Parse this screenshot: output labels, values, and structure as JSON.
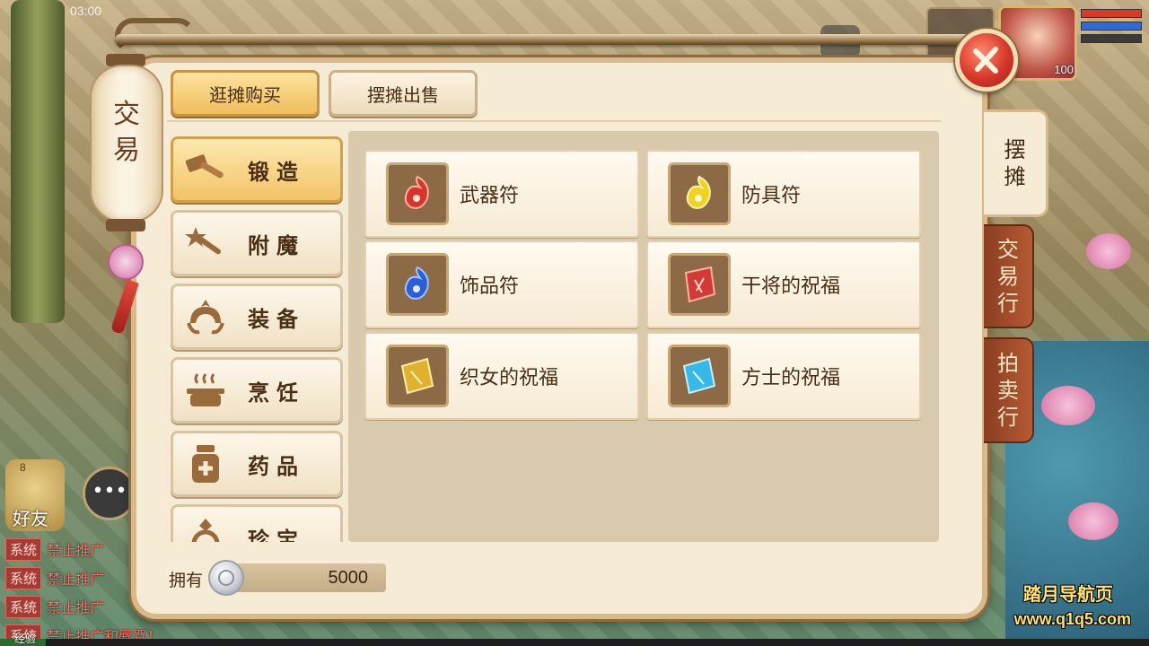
{
  "status_bar": {
    "time": "03:00"
  },
  "hud": {
    "player_level": "100"
  },
  "panel": {
    "title_chars": [
      "交",
      "易"
    ],
    "top_tabs": [
      {
        "label": "逛摊购买",
        "active": true
      },
      {
        "label": "摆摊出售",
        "active": false
      }
    ],
    "side_tabs": [
      {
        "label": "摆\n摊",
        "active": true
      },
      {
        "label": "交\n易\n行",
        "active": false
      },
      {
        "label": "拍\n卖\n行",
        "active": false
      }
    ],
    "categories": [
      {
        "label": "锻造",
        "icon": "hammer-icon",
        "active": true
      },
      {
        "label": "附魔",
        "icon": "magic-wand-icon",
        "active": false
      },
      {
        "label": "装备",
        "icon": "helmet-icon",
        "active": false
      },
      {
        "label": "烹饪",
        "icon": "cooking-pot-icon",
        "active": false
      },
      {
        "label": "药品",
        "icon": "medicine-jar-icon",
        "active": false
      },
      {
        "label": "珍宝",
        "icon": "ring-icon",
        "active": false
      }
    ],
    "items": [
      {
        "name": "武器符",
        "icon": "red-talisman-icon",
        "color": "#d9342b"
      },
      {
        "name": "防具符",
        "icon": "yellow-talisman-icon",
        "color": "#f2d21c"
      },
      {
        "name": "饰品符",
        "icon": "blue-talisman-icon",
        "color": "#2a5fd9"
      },
      {
        "name": "干将的祝福",
        "icon": "red-scroll-icon",
        "color": "#d13a36"
      },
      {
        "name": "织女的祝福",
        "icon": "gold-scroll-icon",
        "color": "#e0b12a"
      },
      {
        "name": "方士的祝福",
        "icon": "cyan-scroll-icon",
        "color": "#36b8e8"
      }
    ],
    "currency": {
      "label": "拥有",
      "amount": "5000",
      "icon": "silver-coin-icon"
    }
  },
  "chat": {
    "friend_label": "好友",
    "friend_count": "8",
    "lines": [
      {
        "tag": "系统",
        "text": "禁止推广"
      },
      {
        "tag": "系统",
        "text": "禁止推广"
      },
      {
        "tag": "系统",
        "text": "禁止推广"
      },
      {
        "tag": "系统",
        "text": "禁止推广和辱骂！"
      }
    ],
    "exp_label": "经验"
  },
  "watermark": {
    "title": "踏月导航页",
    "url": "www.q1q5.com"
  }
}
